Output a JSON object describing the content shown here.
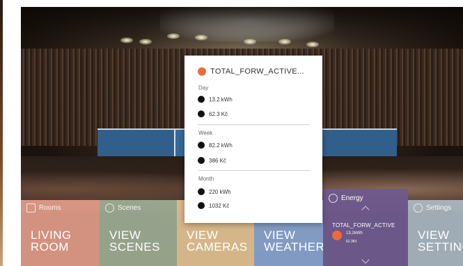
{
  "popup": {
    "title": "TOTAL_FORW_ACTIVE...",
    "sections": [
      {
        "label": "Day",
        "energy": "13.2 kWh",
        "cost": "62.3 Kč"
      },
      {
        "label": "Week",
        "energy": "82.2 kWh",
        "cost": "386 Kč"
      },
      {
        "label": "Month",
        "energy": "220 kWh",
        "cost": "1032 Kč"
      }
    ]
  },
  "tiles": {
    "living": {
      "head": "Rooms",
      "line1": "LIVING",
      "line2": "ROOM"
    },
    "scenes": {
      "head": "Scenes",
      "line1": "VIEW",
      "line2": "SCENES"
    },
    "cameras": {
      "head": "",
      "line1": "VIEW",
      "line2": "CAMERAS"
    },
    "weather": {
      "head": "",
      "line1": "VIEW",
      "line2": "WEATHER"
    },
    "energy": {
      "head": "Energy",
      "mini_title": "TOTAL_FORW_ACTIVE",
      "mini_v1": "13.2kWh",
      "mini_v2": "62.3Kč"
    },
    "settings": {
      "head": "Settings",
      "line1": "VIEW",
      "line2": "SETTING"
    }
  },
  "colors": {
    "accent_orange": "#ef6a3a",
    "rooms_tile": "#e8a08c",
    "scenes_tile": "#a0af96",
    "cameras_tile": "#e8c896",
    "weather_tile": "#8caad7",
    "energy_tile": "#6e5a8c",
    "settings_tile": "#afbec8"
  },
  "icons": [
    "rooms-icon",
    "scenes-icon",
    "energy-icon",
    "settings-icon",
    "chevron-up-icon",
    "chevron-down-icon"
  ]
}
